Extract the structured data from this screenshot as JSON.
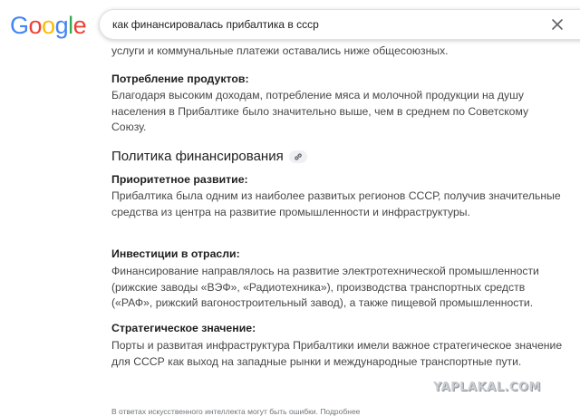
{
  "header": {
    "logo_letters": [
      {
        "char": "G",
        "color": "#4285F4"
      },
      {
        "char": "o",
        "color": "#EA4335"
      },
      {
        "char": "o",
        "color": "#FBBC05"
      },
      {
        "char": "g",
        "color": "#4285F4"
      },
      {
        "char": "l",
        "color": "#34A853"
      },
      {
        "char": "e",
        "color": "#EA4335"
      }
    ],
    "search_value": "как финансировалась прибалтика в ссср",
    "clear_icon": "close-icon"
  },
  "content": {
    "intro_text": "услуги и коммунальные платежи оставались ниже общесоюзных.",
    "consumption": {
      "label": "Потребление продуктов:",
      "text": "Благодаря высоким доходам, потребление мяса и молочной продукции на душу населения в Прибалтике было значительно выше, чем в среднем по Советскому Союзу."
    },
    "section": {
      "title": "Политика финансирования",
      "link_icon": "link-icon"
    },
    "priority": {
      "label": "Приоритетное развитие:",
      "text": "Прибалтика была одним из наиболее развитых регионов СССР, получив значительные средства из центра на развитие промышленности и инфраструктуры."
    },
    "investments": {
      "label": "Инвестиции в отрасли:",
      "text": "Финансирование направлялось на развитие электротехнической промышленности (рижские заводы «ВЭФ», «Радиотехника»), производства транспортных средств («РАФ», рижский вагоностроительный завод), а также пищевой промышленности."
    },
    "strategic": {
      "label": "Стратегическое значение:",
      "text": "Порты и развитая инфраструктура Прибалтики имели важное стратегическое значение для СССР как выход на западные рынки и международные транспортные пути."
    }
  },
  "footer": {
    "disclaimer": "В ответах искусственного интеллекта могут быть ошибки. Подробнее"
  },
  "watermark": "YAPLAKAL.COM"
}
